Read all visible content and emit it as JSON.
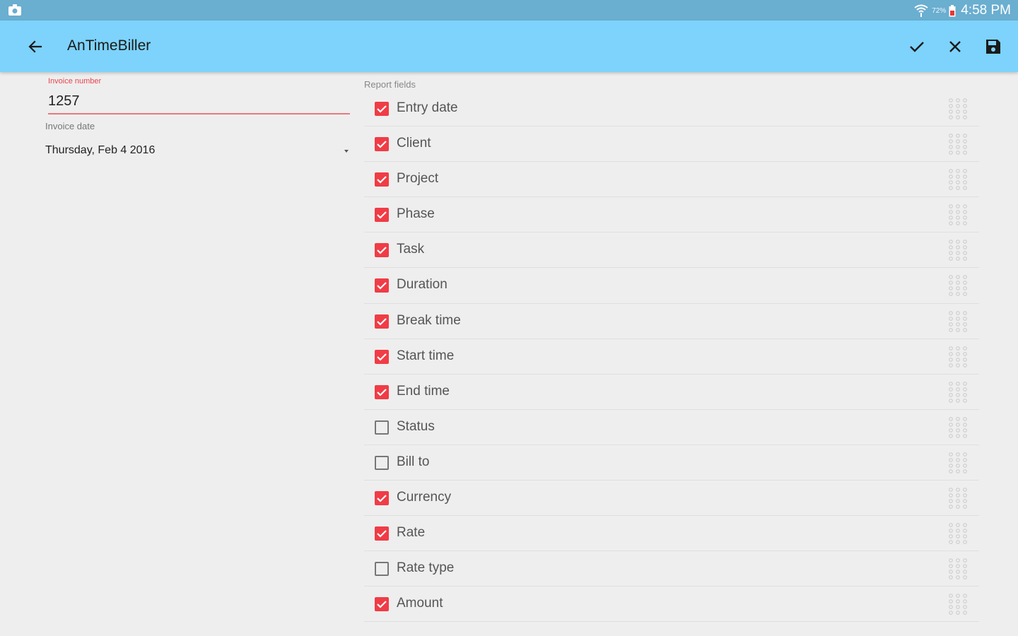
{
  "statusbar": {
    "battery_percent": "72%",
    "time": "4:58 PM"
  },
  "appbar": {
    "title": "AnTimeBiller",
    "icons": [
      "arrow-left-icon",
      "check-icon",
      "close-icon",
      "save-icon"
    ]
  },
  "invoice": {
    "number_label": "Invoice number",
    "number_value": "1257",
    "date_label": "Invoice date",
    "date_value": "Thursday, Feb 4 2016"
  },
  "report": {
    "label": "Report fields",
    "fields": [
      {
        "label": "Entry date",
        "checked": true
      },
      {
        "label": "Client",
        "checked": true
      },
      {
        "label": "Project",
        "checked": true
      },
      {
        "label": "Phase",
        "checked": true
      },
      {
        "label": "Task",
        "checked": true
      },
      {
        "label": "Duration",
        "checked": true
      },
      {
        "label": "Break time",
        "checked": true
      },
      {
        "label": "Start time",
        "checked": true
      },
      {
        "label": "End time",
        "checked": true
      },
      {
        "label": "Status",
        "checked": false
      },
      {
        "label": "Bill to",
        "checked": false
      },
      {
        "label": "Currency",
        "checked": true
      },
      {
        "label": "Rate",
        "checked": true
      },
      {
        "label": "Rate type",
        "checked": false
      },
      {
        "label": "Amount",
        "checked": true
      }
    ]
  },
  "colors": {
    "statusbar": "#6aaed0",
    "appbar": "#7dd3fb",
    "accent": "#f03c46",
    "background": "#eeeeee"
  }
}
